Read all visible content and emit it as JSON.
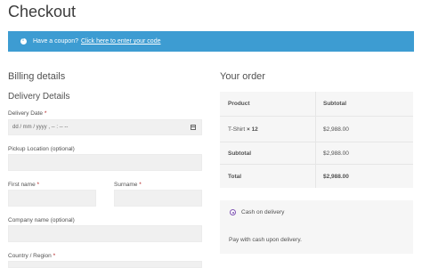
{
  "page": {
    "title": "Checkout"
  },
  "notice": {
    "text": "Have a coupon?",
    "link": "Click here to enter your code"
  },
  "billing": {
    "heading": "Billing details",
    "delivery_heading": "Delivery Details",
    "delivery_date": {
      "label": "Delivery Date",
      "required": "*",
      "placeholder": "dd / mm / yyyy , -- : --  --"
    },
    "pickup_location": {
      "label": "Pickup Location (optional)"
    },
    "first_name": {
      "label": "First name",
      "required": "*"
    },
    "surname": {
      "label": "Surname",
      "required": "*"
    },
    "company": {
      "label": "Company name (optional)"
    },
    "country": {
      "label": "Country / Region",
      "required": "*"
    }
  },
  "order": {
    "heading": "Your order",
    "col_product": "Product",
    "col_subtotal": "Subtotal",
    "item_name": "T-Shirt",
    "item_qty": "× 12",
    "item_total": "$2,988.00",
    "subtotal_label": "Subtotal",
    "subtotal_value": "$2,988.00",
    "total_label": "Total",
    "total_value": "$2,988.00"
  },
  "payment": {
    "method": "Cash on delivery",
    "description": "Pay with cash upon delivery."
  },
  "colors": {
    "notice_bg": "#3d9cd2",
    "radio_accent": "#7f54b3",
    "table_bg": "#f6f6f6"
  }
}
